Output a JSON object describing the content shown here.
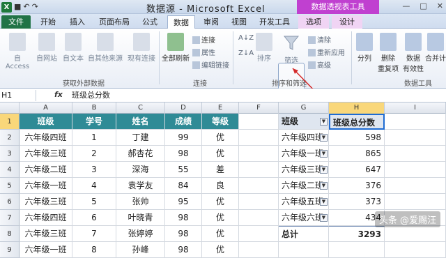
{
  "window": {
    "title": "数据源 - Microsoft Excel",
    "context_title": "数据透视表工具",
    "controls": [
      "—",
      "□",
      "✕"
    ]
  },
  "qat": {
    "logo": "X",
    "undo": "↶",
    "redo": "↷"
  },
  "tabs": [
    "文件",
    "开始",
    "插入",
    "页面布局",
    "公式",
    "数据",
    "审阅",
    "视图",
    "开发工具",
    "选项",
    "设计"
  ],
  "ribbon": {
    "external": {
      "access": "自 Access",
      "web": "自网站",
      "text": "自文本",
      "other": "自其他来源",
      "existing": "现有连接",
      "label": "获取外部数据"
    },
    "connections": {
      "refresh_all": "全部刷新",
      "connections": "连接",
      "properties": "属性",
      "edit_links": "编辑链接",
      "label": "连接"
    },
    "sort": {
      "az": "A↓Z",
      "za": "Z↓A",
      "sort": "排序",
      "filter": "筛选",
      "clear": "清除",
      "reapply": "重新应用",
      "advanced": "高级",
      "label": "排序和筛选"
    },
    "tools": {
      "split": "分列",
      "remove_dup": "删除\n重复项",
      "validation": "数据\n有效性",
      "consolidate": "合并计",
      "label": "数据工具"
    }
  },
  "formula": {
    "namebox": "H1",
    "fx": "fx",
    "content": "班级总分数"
  },
  "columns": [
    "A",
    "B",
    "C",
    "D",
    "E",
    "F",
    "G",
    "H",
    "I"
  ],
  "rows": [
    "1",
    "2",
    "3",
    "4",
    "5",
    "6",
    "7",
    "8",
    "9"
  ],
  "table": {
    "headers": [
      "班级",
      "学号",
      "姓名",
      "成绩",
      "等级"
    ],
    "data": [
      [
        "六年级四班",
        "1",
        "丁建",
        "99",
        "优"
      ],
      [
        "六年级三班",
        "2",
        "郝杏花",
        "98",
        "优"
      ],
      [
        "六年级二班",
        "3",
        "深海",
        "55",
        "差"
      ],
      [
        "六年级一班",
        "4",
        "袁学友",
        "84",
        "良"
      ],
      [
        "六年级三班",
        "5",
        "张帅",
        "95",
        "优"
      ],
      [
        "六年级四班",
        "6",
        "叶晓青",
        "98",
        "优"
      ],
      [
        "六年级三班",
        "7",
        "张婷婷",
        "98",
        "优"
      ],
      [
        "六年级一班",
        "8",
        "孙峰",
        "98",
        "优"
      ]
    ]
  },
  "pivot": {
    "h_class": "班级",
    "h_total": "班级总分数",
    "rows": [
      [
        "六年级四班",
        "598"
      ],
      [
        "六年级一班",
        "865"
      ],
      [
        "六年级三班",
        "647"
      ],
      [
        "六年级二班",
        "376"
      ],
      [
        "六年级五班",
        "373"
      ],
      [
        "六年级六班",
        "434"
      ]
    ],
    "total_label": "总计",
    "total_value": "3293"
  },
  "watermark": "头条 @爱赐汪"
}
